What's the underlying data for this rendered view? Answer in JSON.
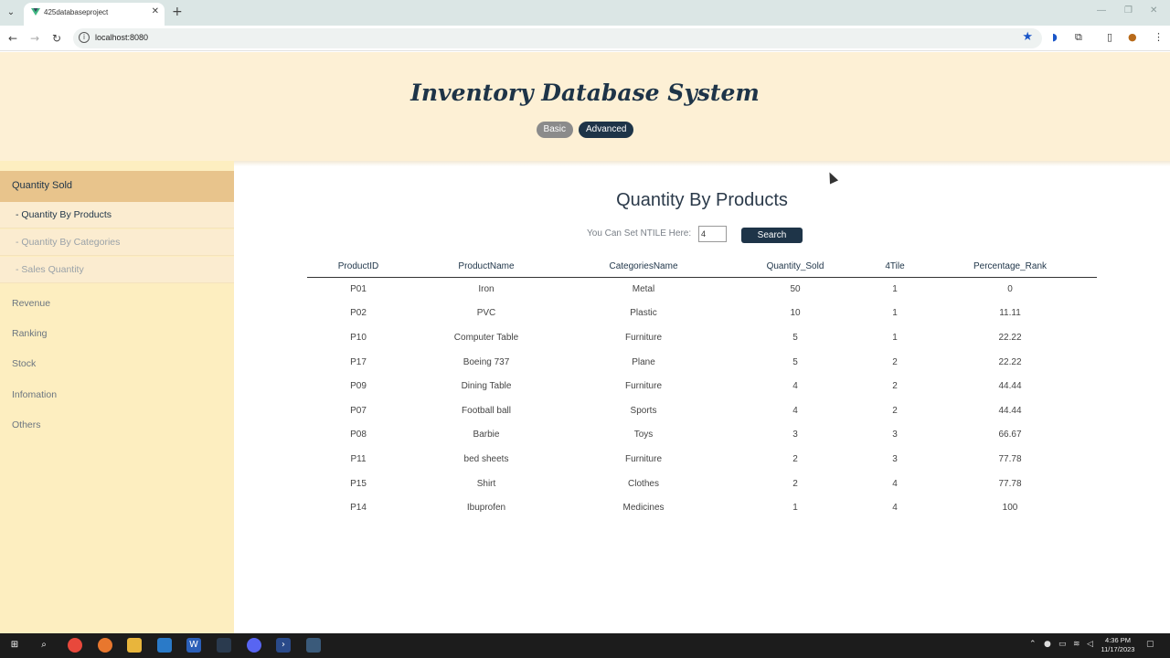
{
  "browser": {
    "tab_title": "425databaseproject",
    "url": "localhost:8080"
  },
  "app": {
    "title": "Inventory Database System",
    "modes": [
      "Basic",
      "Advanced"
    ],
    "active_mode": "Advanced"
  },
  "sidebar": {
    "active_section": "Quantity Sold",
    "sub_items": [
      "- Quantity By Products",
      "- Quantity By Categories",
      "- Sales Quantity"
    ],
    "active_sub_item": "- Quantity By Products",
    "sections": [
      "Revenue",
      "Ranking",
      "Stock",
      "Infomation",
      "Others"
    ]
  },
  "main": {
    "title": "Quantity By Products",
    "ntile_label": "You Can Set NTILE Here:",
    "ntile_value": "4",
    "search_label": "Search",
    "table": {
      "columns": [
        "ProductID",
        "ProductName",
        "CategoriesName",
        "Quantity_Sold",
        "4Tile",
        "Percentage_Rank"
      ],
      "rows": [
        [
          "P01",
          "Iron",
          "Metal",
          "50",
          "1",
          "0"
        ],
        [
          "P02",
          "PVC",
          "Plastic",
          "10",
          "1",
          "11.11"
        ],
        [
          "P10",
          "Computer Table",
          "Furniture",
          "5",
          "1",
          "22.22"
        ],
        [
          "P17",
          "Boeing 737",
          "Plane",
          "5",
          "2",
          "22.22"
        ],
        [
          "P09",
          "Dining Table",
          "Furniture",
          "4",
          "2",
          "44.44"
        ],
        [
          "P07",
          "Football ball",
          "Sports",
          "4",
          "2",
          "44.44"
        ],
        [
          "P08",
          "Barbie",
          "Toys",
          "3",
          "3",
          "66.67"
        ],
        [
          "P11",
          "bed sheets",
          "Furniture",
          "2",
          "3",
          "77.78"
        ],
        [
          "P15",
          "Shirt",
          "Clothes",
          "2",
          "4",
          "77.78"
        ],
        [
          "P14",
          "Ibuprofen",
          "Medicines",
          "1",
          "4",
          "100"
        ]
      ]
    }
  },
  "taskbar": {
    "time": "4:36 PM",
    "date": "11/17/2023"
  },
  "colors": {
    "header_bg": "#fdf0d5",
    "sidebar_bg": "#fdeec0",
    "sidebar_active": "#e8c48c",
    "navy": "#1e3448"
  }
}
